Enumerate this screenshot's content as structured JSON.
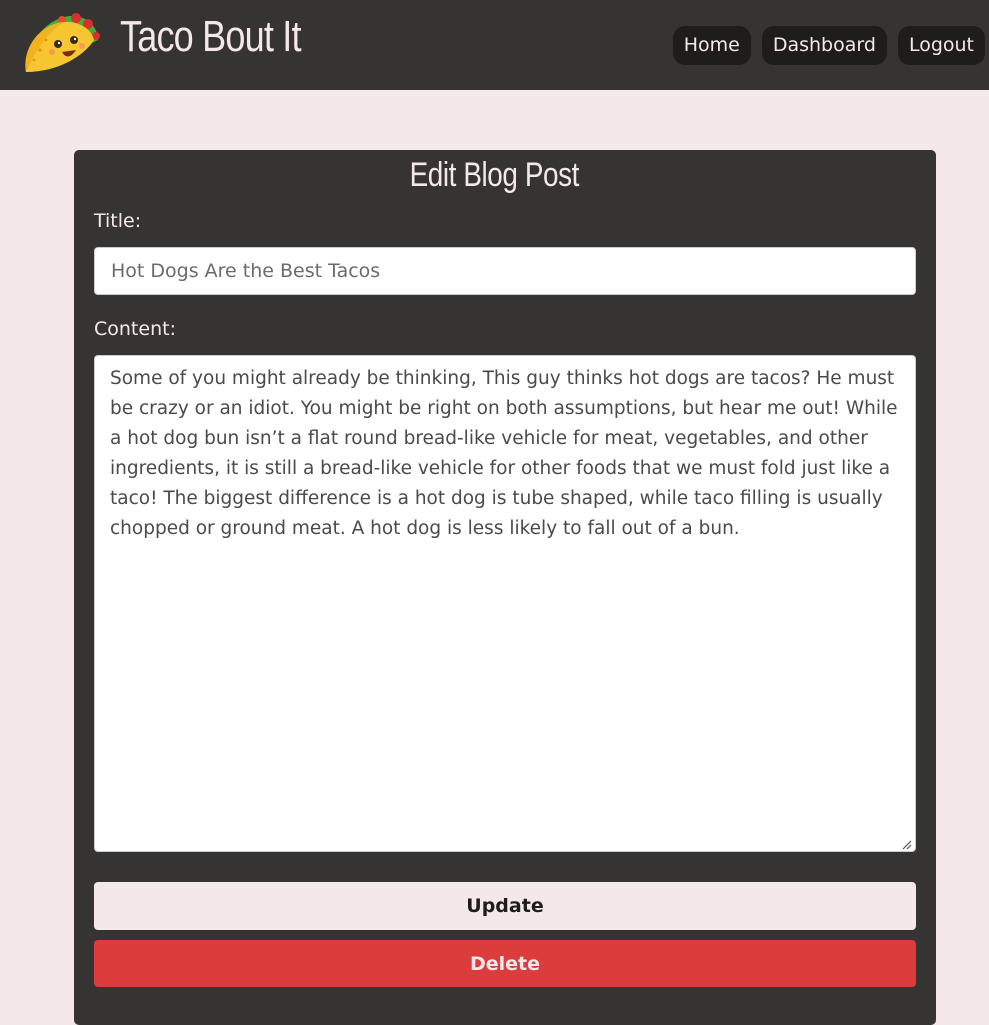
{
  "brand": {
    "name": "Taco Bout It",
    "logo_icon": "taco-icon"
  },
  "nav": {
    "items": [
      {
        "label": "Home"
      },
      {
        "label": "Dashboard"
      },
      {
        "label": "Logout"
      }
    ]
  },
  "form": {
    "heading": "Edit Blog Post",
    "title_label": "Title:",
    "title_value": "Hot Dogs Are the Best Tacos",
    "content_label": "Content:",
    "content_value": "Some of you might already be thinking, This guy thinks hot dogs are tacos? He must be crazy or an idiot. You might be right on both assumptions, but hear me out! While a hot dog bun isn’t a flat round bread-like vehicle for meat, vegetables, and other ingredients, it is still a bread-like vehicle for other foods that we must fold just like a taco! The biggest difference is a hot dog is tube shaped, while taco filling is usually chopped or ground meat. A hot dog is less likely to fall out of a bun.",
    "update_label": "Update",
    "delete_label": "Delete"
  },
  "colors": {
    "background": "#f5e8e8",
    "navbar": "#363432",
    "card": "#363432",
    "nav_button": "#1f1d1c",
    "update_button": "#f5e8e8",
    "delete_button": "#dc3c3c"
  }
}
